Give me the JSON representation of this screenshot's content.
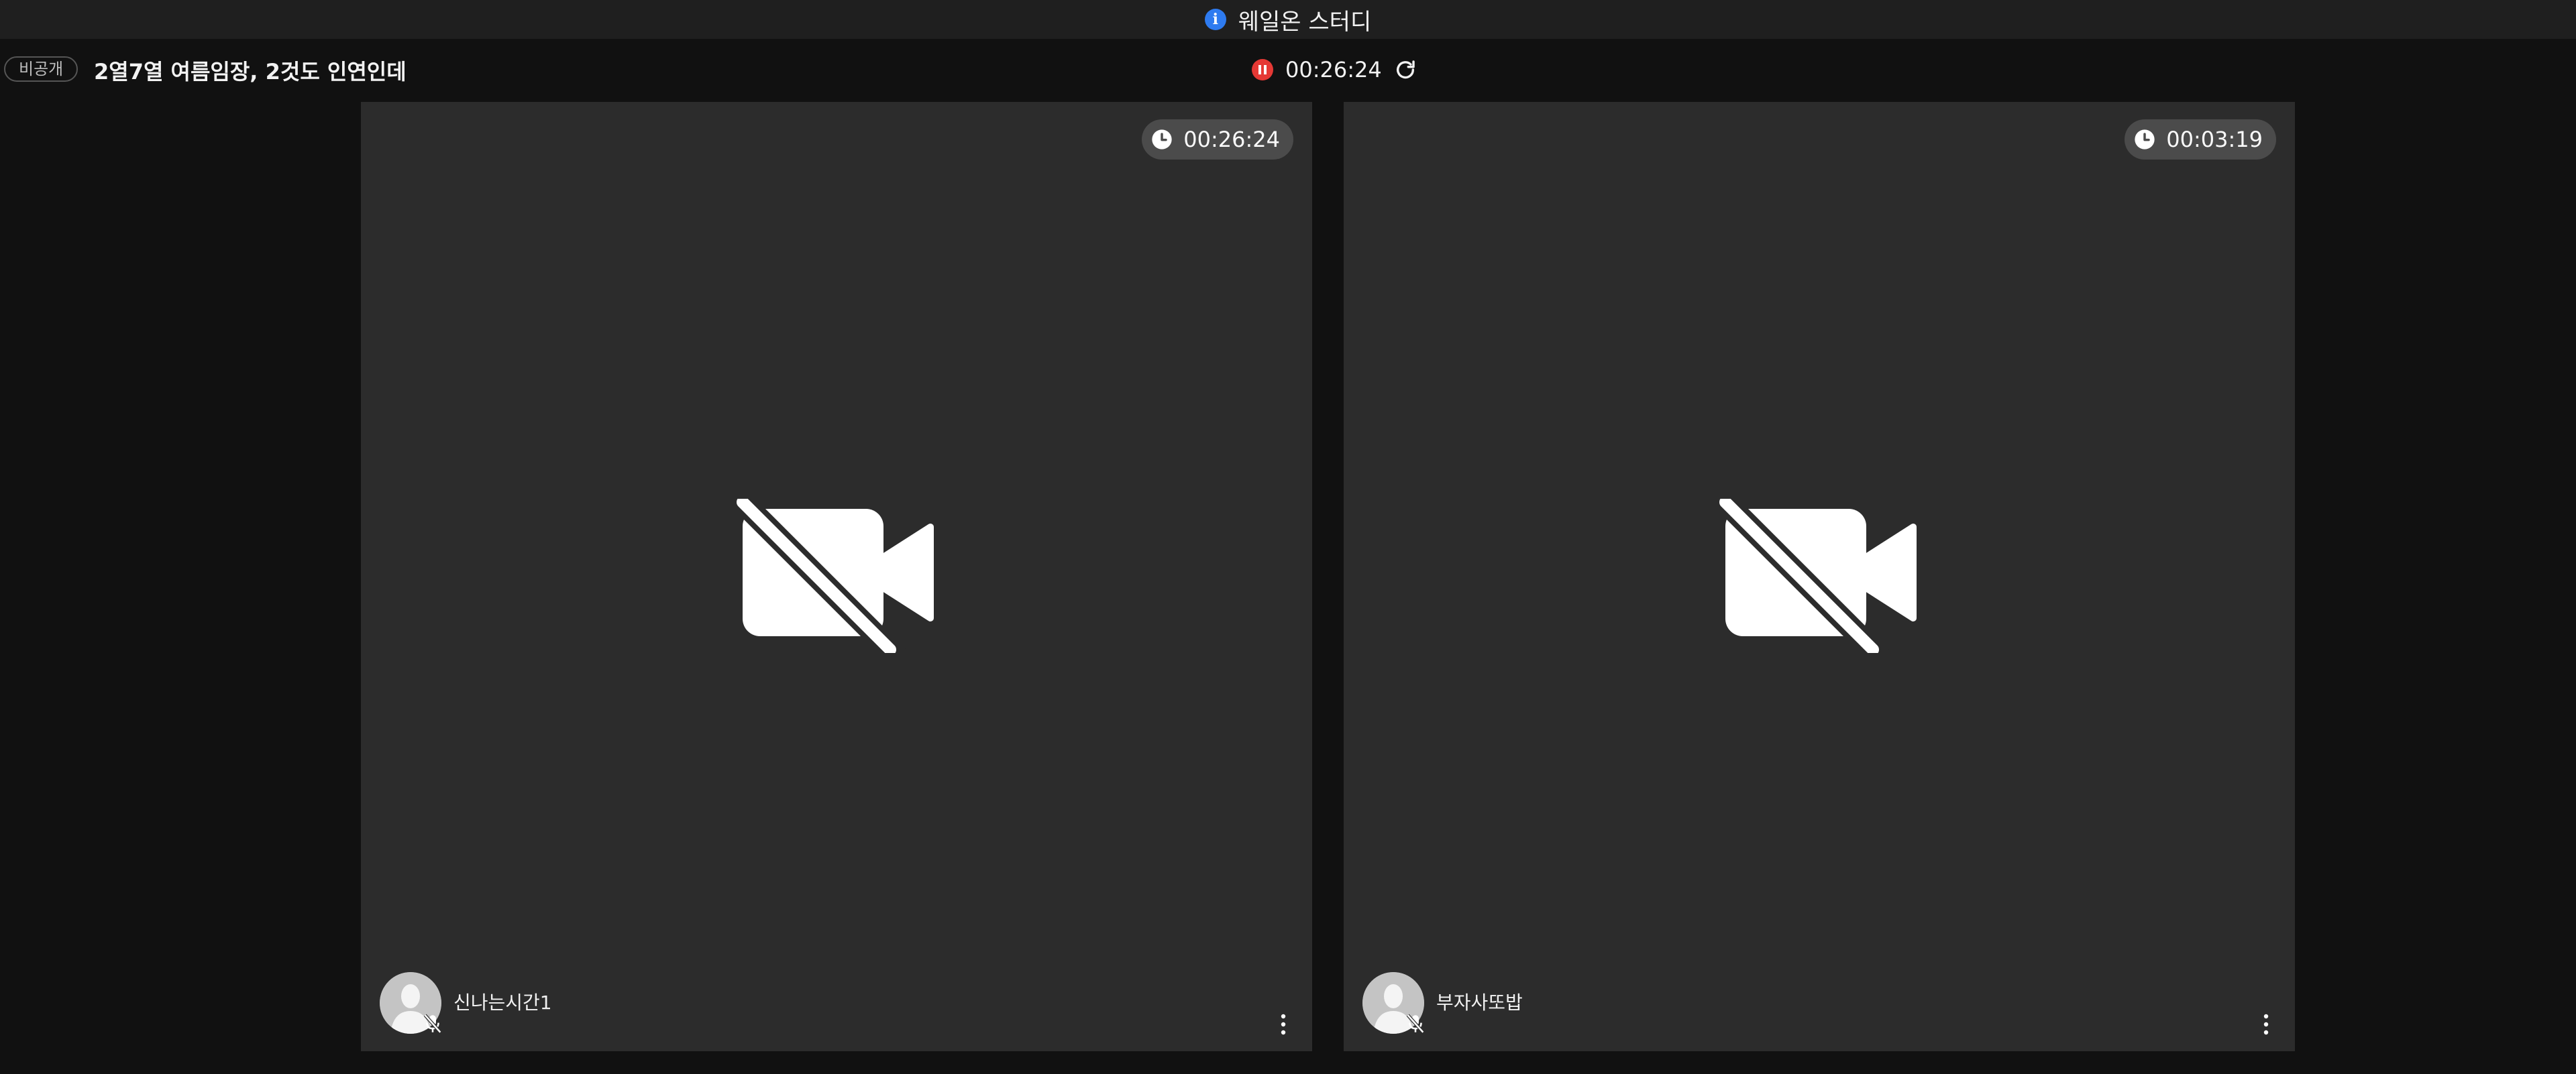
{
  "app": {
    "title": "웨일온 스터디",
    "info_icon": "info-icon",
    "info_glyph": "i"
  },
  "room": {
    "visibility_badge": "비공개",
    "title": "2열7열 여름임장, 2것도 인연인데",
    "elapsed_time": "00:26:24",
    "record_icon": "pause-record-icon",
    "refresh_icon": "refresh-icon"
  },
  "participants": [
    {
      "name": "신나는시간1",
      "timer": "00:26:24",
      "camera": "off",
      "microphone": "muted"
    },
    {
      "name": "부자사또밥",
      "timer": "00:03:19",
      "camera": "off",
      "microphone": "muted"
    }
  ],
  "colors": {
    "background": "#111111",
    "topbar": "#1f1f1f",
    "tile": "#2c2c2c",
    "record_red": "#e53935",
    "info_blue": "#2e7bf0",
    "timer_pill": "#4b4b4b"
  }
}
